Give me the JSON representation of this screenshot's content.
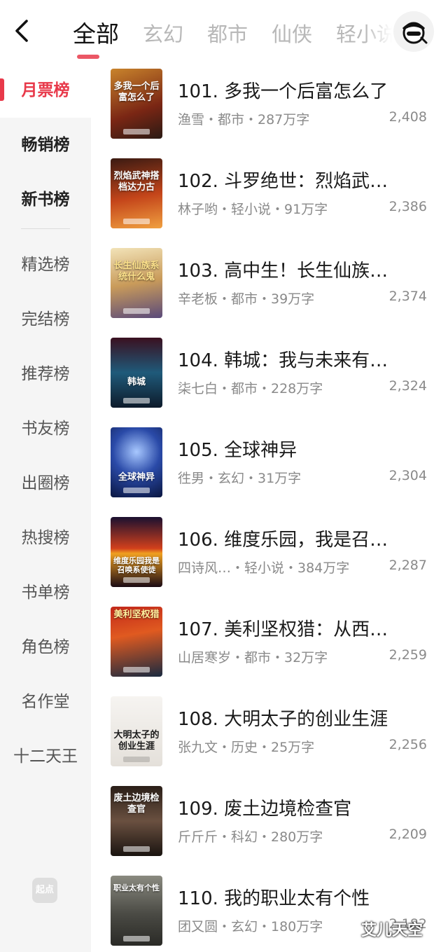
{
  "header": {
    "tabs": [
      "全部",
      "玄幻",
      "都市",
      "仙侠",
      "轻小说"
    ]
  },
  "sidebar": {
    "items": [
      {
        "label": "月票榜"
      },
      {
        "label": "畅销榜"
      },
      {
        "label": "新书榜"
      },
      {
        "label": "精选榜"
      },
      {
        "label": "完结榜"
      },
      {
        "label": "推荐榜"
      },
      {
        "label": "书友榜"
      },
      {
        "label": "出圈榜"
      },
      {
        "label": "热搜榜"
      },
      {
        "label": "书单榜"
      },
      {
        "label": "角色榜"
      },
      {
        "label": "名作堂"
      },
      {
        "label": "十二天王"
      }
    ],
    "logo_text": "起点"
  },
  "books": [
    {
      "title": "101. 多我一个后富怎么了",
      "meta": "渔雪・都市・287万字",
      "count": "2,408",
      "cover_text": "多我一个后富怎么了",
      "cover_color": "#8a2a1a"
    },
    {
      "title": "102. 斗罗绝世：烈焰武…",
      "meta": "林子哟・轻小说・91万字",
      "count": "2,386",
      "cover_text": "烈焰武神搭档达力古",
      "cover_color": "#b8461c"
    },
    {
      "title": "103. 高中生！长生仙族…",
      "meta": "辛老板・都市・39万字",
      "count": "2,374",
      "cover_text": "长生仙族系统什么鬼",
      "cover_color": "#c9a56a"
    },
    {
      "title": "104. 韩城：我与未来有…",
      "meta": "柒七白・都市・228万字",
      "count": "2,324",
      "cover_text": "韩城",
      "cover_color": "#1f3f5e"
    },
    {
      "title": "105. 全球神异",
      "meta": "徃男・玄幻・31万字",
      "count": "2,304",
      "cover_text": "全球神异",
      "cover_color": "#1c3c8a"
    },
    {
      "title": "106. 维度乐园，我是召…",
      "meta": "四诗风…・轻小说・384万字",
      "count": "2,287",
      "cover_text": "维度乐园我是召唤系使徒",
      "cover_color": "#c2401f"
    },
    {
      "title": "107. 美利坚权猎：从西…",
      "meta": "山居寒岁・都市・32万字",
      "count": "2,259",
      "cover_text": "美利坚权猎",
      "cover_color": "#a02418"
    },
    {
      "title": "108. 大明太子的创业生涯",
      "meta": "张九文・历史・25万字",
      "count": "2,256",
      "cover_text": "大明太子的创业生涯",
      "cover_color": "#e9e6e2"
    },
    {
      "title": "109. 废土边境检查官",
      "meta": "斤斤斤・科幻・280万字",
      "count": "2,209",
      "cover_text": "废土边境检查官",
      "cover_color": "#4a3a30"
    },
    {
      "title": "110. 我的职业太有个性",
      "meta": "团又圆・玄幻・180万字",
      "count": "2,182",
      "cover_text": "职业太有个性",
      "cover_color": "#5a5a52"
    }
  ],
  "watermark": "艾儿天空",
  "colors": {
    "accent": "#e8394a"
  }
}
